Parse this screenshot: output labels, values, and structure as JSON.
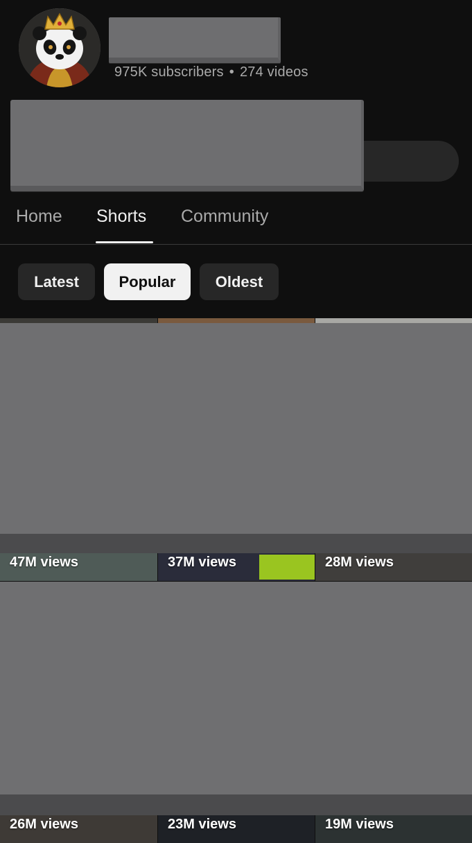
{
  "channel": {
    "avatar_icon": "panda-king-avatar-icon",
    "subscribers": "975K subscribers",
    "separator": "•",
    "videos": "274 videos"
  },
  "tabs": [
    {
      "label": "Home",
      "active": false
    },
    {
      "label": "Shorts",
      "active": true
    },
    {
      "label": "Community",
      "active": false
    }
  ],
  "filters": [
    {
      "label": "Latest",
      "selected": false
    },
    {
      "label": "Popular",
      "selected": true
    },
    {
      "label": "Oldest",
      "selected": false
    }
  ],
  "shorts": {
    "row1": [
      {
        "views": "47M views"
      },
      {
        "views": "37M views"
      },
      {
        "views": "28M views"
      }
    ],
    "row2": [
      {
        "views": "26M views"
      },
      {
        "views": "23M views"
      },
      {
        "views": "19M views"
      }
    ]
  },
  "colors": {
    "background": "#0f0f0f",
    "chip": "#272727",
    "chip_selected": "#f1f1f1",
    "redaction": "#6f6f71",
    "secondary_text": "#aaaaaa"
  }
}
